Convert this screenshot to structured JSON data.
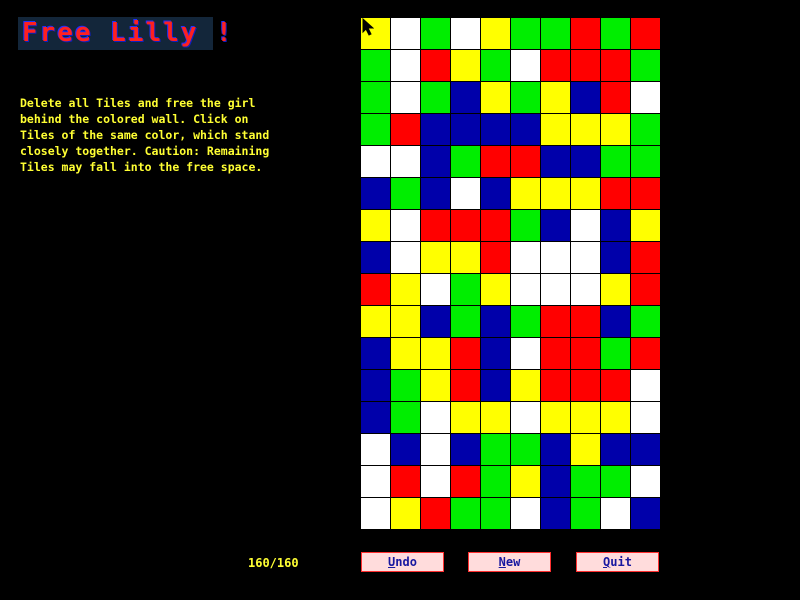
{
  "title": "Free Lilly !",
  "instructions": "Delete all Tiles and free the girl\nbehind the colored wall. Click on\nTiles of the same color, which stand\nclosely together. Caution: Remaining\nTiles may fall into the free space.",
  "counter": "160/160",
  "buttons": {
    "undo": {
      "hotkey": "U",
      "rest": "ndo"
    },
    "new": {
      "hotkey": "N",
      "rest": "ew"
    },
    "quit": {
      "hotkey": "Q",
      "rest": "uit"
    }
  },
  "colors": {
    "W": "#ffffff",
    "G": "#00ee00",
    "R": "#ff0000",
    "Y": "#ffff00",
    "B": "#0000aa"
  },
  "board": {
    "columns": 10,
    "rows": [
      "YWGWYGGRGR",
      "GWRYGWRRRG",
      "GWGBYGYBRW",
      "GRBBBBYYYG",
      "WWBGRRBBGG",
      "BGBWBYYYRR",
      "YWRRRGBWBY",
      "BWYYRWWWBR",
      "RYWGYWWWYR",
      "YYBGBGRRBG",
      "BYYRBWRRGR",
      "BGYRBYRRRW",
      "BGWYYWYYYW",
      "WBWBGGBYBB",
      "WRWRGYBGGW",
      "WYRGGWBGWB"
    ]
  }
}
